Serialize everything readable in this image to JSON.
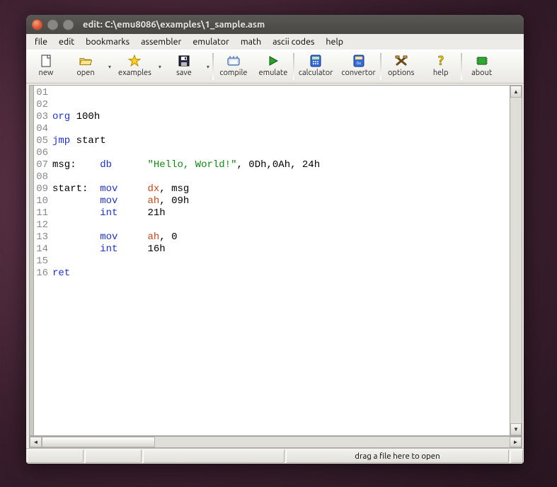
{
  "title": "edit: C:\\emu8086\\examples\\1_sample.asm",
  "menu": [
    "file",
    "edit",
    "bookmarks",
    "assembler",
    "emulator",
    "math",
    "ascii codes",
    "help"
  ],
  "toolbar": [
    {
      "icon": "new",
      "label": "new",
      "drop": false
    },
    {
      "icon": "open",
      "label": "open",
      "drop": true
    },
    {
      "icon": "star",
      "label": "examples",
      "drop": true
    },
    {
      "icon": "save",
      "label": "save",
      "drop": true
    },
    {
      "sep": true
    },
    {
      "icon": "compile",
      "label": "compile",
      "drop": false
    },
    {
      "icon": "play",
      "label": "emulate",
      "drop": false
    },
    {
      "sep": true
    },
    {
      "icon": "calc",
      "label": "calculator",
      "drop": false
    },
    {
      "icon": "conv",
      "label": "convertor",
      "drop": false
    },
    {
      "sep": true
    },
    {
      "icon": "opts",
      "label": "options",
      "drop": false
    },
    {
      "icon": "help",
      "label": "help",
      "drop": false
    },
    {
      "sep": true
    },
    {
      "icon": "chip",
      "label": "about",
      "drop": false
    }
  ],
  "code_lines": [
    {
      "n": "01",
      "tokens": []
    },
    {
      "n": "02",
      "tokens": []
    },
    {
      "n": "03",
      "tokens": [
        {
          "t": "org",
          "c": "kw"
        },
        {
          "t": " 100h",
          "c": "num"
        }
      ]
    },
    {
      "n": "04",
      "tokens": []
    },
    {
      "n": "05",
      "tokens": [
        {
          "t": "jmp",
          "c": "kw"
        },
        {
          "t": " start",
          "c": "lbl"
        }
      ]
    },
    {
      "n": "06",
      "tokens": []
    },
    {
      "n": "07",
      "tokens": [
        {
          "t": "msg:    ",
          "c": "lbl"
        },
        {
          "t": "db",
          "c": "kw"
        },
        {
          "t": "      ",
          "c": ""
        },
        {
          "t": "\"Hello, World!\"",
          "c": "str"
        },
        {
          "t": ", 0Dh,0Ah, 24h",
          "c": "num"
        }
      ]
    },
    {
      "n": "08",
      "tokens": []
    },
    {
      "n": "09",
      "tokens": [
        {
          "t": "start:  ",
          "c": "lbl"
        },
        {
          "t": "mov",
          "c": "kw"
        },
        {
          "t": "     ",
          "c": ""
        },
        {
          "t": "dx",
          "c": "reg"
        },
        {
          "t": ", msg",
          "c": "lbl"
        }
      ]
    },
    {
      "n": "10",
      "tokens": [
        {
          "t": "        ",
          "c": ""
        },
        {
          "t": "mov",
          "c": "kw"
        },
        {
          "t": "     ",
          "c": ""
        },
        {
          "t": "ah",
          "c": "reg"
        },
        {
          "t": ", 09h",
          "c": "num"
        }
      ]
    },
    {
      "n": "11",
      "tokens": [
        {
          "t": "        ",
          "c": ""
        },
        {
          "t": "int",
          "c": "kw"
        },
        {
          "t": "     21h",
          "c": "num"
        }
      ]
    },
    {
      "n": "12",
      "tokens": []
    },
    {
      "n": "13",
      "tokens": [
        {
          "t": "        ",
          "c": ""
        },
        {
          "t": "mov",
          "c": "kw"
        },
        {
          "t": "     ",
          "c": ""
        },
        {
          "t": "ah",
          "c": "reg"
        },
        {
          "t": ", 0",
          "c": "num"
        }
      ]
    },
    {
      "n": "14",
      "tokens": [
        {
          "t": "        ",
          "c": ""
        },
        {
          "t": "int",
          "c": "kw"
        },
        {
          "t": "     16h",
          "c": "num"
        }
      ]
    },
    {
      "n": "15",
      "tokens": []
    },
    {
      "n": "16",
      "tokens": [
        {
          "t": "ret",
          "c": "kw"
        }
      ]
    }
  ],
  "status": {
    "drop_hint": "drag a file here to open"
  }
}
